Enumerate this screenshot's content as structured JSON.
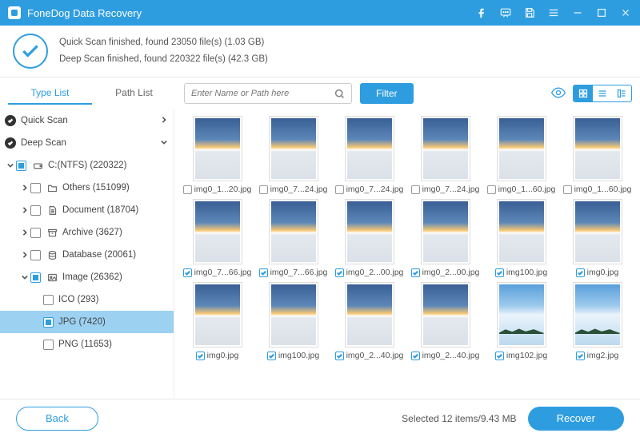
{
  "title": "FoneDog Data Recovery",
  "summary": {
    "quick": "Quick Scan finished, found 23050 file(s) (1.03 GB)",
    "deep": "Deep Scan finished, found 220322 file(s) (42.3 GB)"
  },
  "tabs": {
    "type": "Type List",
    "path": "Path List"
  },
  "search": {
    "placeholder": "Enter Name or Path here"
  },
  "filter": "Filter",
  "tree": {
    "quick": "Quick Scan",
    "deep": "Deep Scan",
    "drive": "C:(NTFS) (220322)",
    "others": "Others (151099)",
    "document": "Document (18704)",
    "archive": "Archive (3627)",
    "database": "Database (20061)",
    "image": "Image (26362)",
    "ico": "ICO (293)",
    "jpg": "JPG (7420)",
    "png": "PNG (11653)"
  },
  "files": [
    {
      "name": "img0_1...20.jpg",
      "checked": false,
      "island": false
    },
    {
      "name": "img0_7...24.jpg",
      "checked": false,
      "island": false
    },
    {
      "name": "img0_7...24.jpg",
      "checked": false,
      "island": false
    },
    {
      "name": "img0_7...24.jpg",
      "checked": false,
      "island": false
    },
    {
      "name": "img0_1...60.jpg",
      "checked": false,
      "island": false
    },
    {
      "name": "img0_1...60.jpg",
      "checked": false,
      "island": false
    },
    {
      "name": "img0_7...66.jpg",
      "checked": true,
      "island": false
    },
    {
      "name": "img0_7...66.jpg",
      "checked": true,
      "island": false
    },
    {
      "name": "img0_2...00.jpg",
      "checked": true,
      "island": false
    },
    {
      "name": "img0_2...00.jpg",
      "checked": true,
      "island": false
    },
    {
      "name": "img100.jpg",
      "checked": true,
      "island": false
    },
    {
      "name": "img0.jpg",
      "checked": true,
      "island": false
    },
    {
      "name": "img0.jpg",
      "checked": true,
      "island": false
    },
    {
      "name": "img100.jpg",
      "checked": true,
      "island": false
    },
    {
      "name": "img0_2...40.jpg",
      "checked": true,
      "island": false
    },
    {
      "name": "img0_2...40.jpg",
      "checked": true,
      "island": false
    },
    {
      "name": "img102.jpg",
      "checked": true,
      "island": true
    },
    {
      "name": "img2.jpg",
      "checked": true,
      "island": true
    }
  ],
  "footer": {
    "back": "Back",
    "status": "Selected 12 items/9.43 MB",
    "recover": "Recover"
  }
}
